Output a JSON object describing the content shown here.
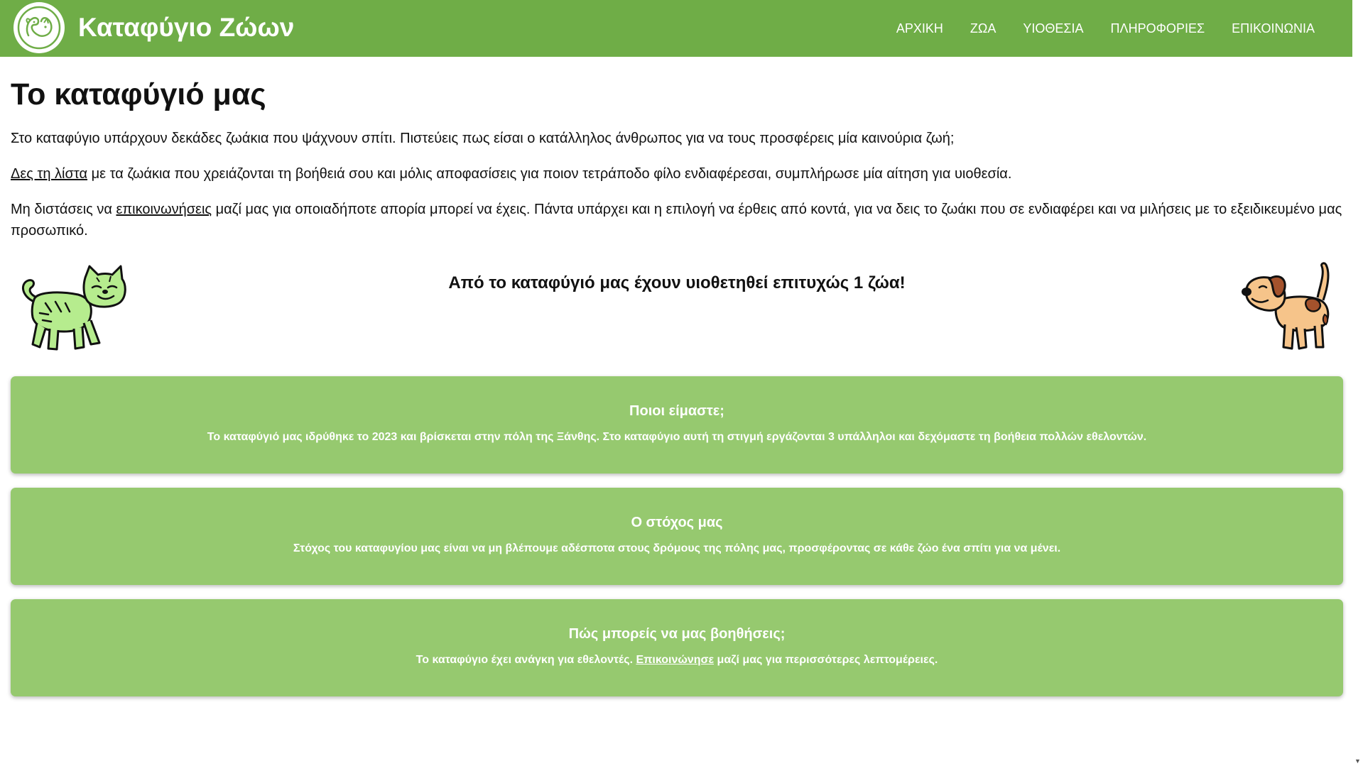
{
  "header": {
    "brand": "Καταφύγιο Ζώων",
    "nav": [
      "ΑΡΧΙΚΗ",
      "ΖΩΑ",
      "ΥΙΟΘΕΣΙΑ",
      "ΠΛΗΡΟΦΟΡΙΕΣ",
      "ΕΠΙΚΟΙΝΩΝΙΑ"
    ],
    "color": "#6fad47"
  },
  "main": {
    "title": "Το καταφύγιό μας",
    "p1": "Στο καταφύγιο υπάρχουν δεκάδες ζωάκια που ψάχνουν σπίτι. Πιστεύεις πως είσαι ο κατάλληλος άνθρωπος για να τους προσφέρεις μία καινούρια ζωή;",
    "p2_link": "Δες τη λίστα",
    "p2_rest": " με τα ζωάκια που χρειάζονται τη βοήθειά σου και μόλις αποφασίσεις για ποιον τετράποδο φίλο ενδιαφέρεσαι, συμπλήρωσε μία αίτηση για υιοθεσία.",
    "p3_start": "Μη διστάσεις να ",
    "p3_link": "επικοινωνήσεις",
    "p3_rest": " μαζί μας για οποιαδήποτε απορία μπορεί να έχεις. Πάντα υπάρχει και η επιλογή να έρθεις από κοντά, για να δεις το ζωάκι που σε ενδιαφέρει και να μιλήσεις με το εξειδικευμένο μας προσωπικό.",
    "adopted": "Από το καταφύγιό μας έχουν υιοθετηθεί επιτυχώς 1 ζώα!"
  },
  "cards": [
    {
      "title": "Ποιοι είμαστε;",
      "text": "Το καταφύγιό μας ιδρύθηκε το 2023 και βρίσκεται στην πόλη της Ξάνθης. Στο καταφύγιο αυτή τη στιγμή εργάζονται 3 υπάλληλοι και δεχόμαστε τη βοήθεια πολλών εθελοντών."
    },
    {
      "title": "Ο στόχος μας",
      "text": "Στόχος του καταφυγίου μας είναι να μη βλέπουμε αδέσποτα στους δρόμους της πόλης μας, προσφέροντας σε κάθε ζώο ένα σπίτι για να μένει."
    },
    {
      "title": "Πώς μπορείς να μας βοηθήσεις;",
      "text_start": "Το καταφύγιο έχει ανάγκη για εθελοντές. ",
      "link": "Επικοινώνησε",
      "text_end": " μαζί μας για περισσότερες λεπτομέρειες."
    }
  ],
  "colors": {
    "card": "#96c96f",
    "cat": "#b6ec8e",
    "dog_body": "#f6c48a",
    "dog_spot": "#a4522c"
  },
  "icons": {
    "logo": "dog-cat-logo-icon",
    "cat": "cat-illustration",
    "dog": "dog-illustration",
    "scroll_down": "▼"
  }
}
